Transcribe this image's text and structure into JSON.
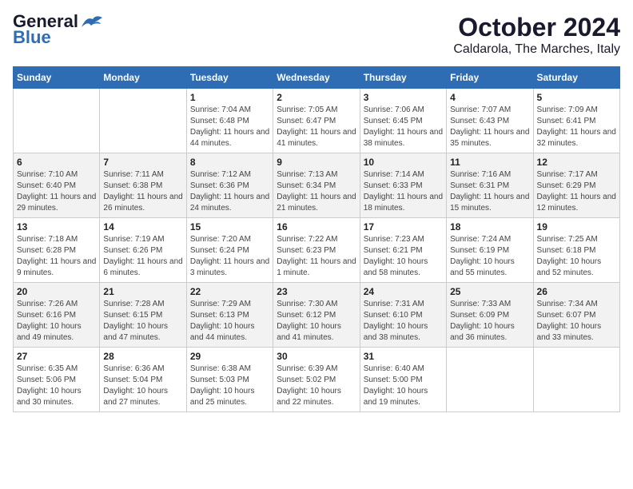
{
  "logo": {
    "line1": "General",
    "line2": "Blue"
  },
  "title": "October 2024",
  "subtitle": "Caldarola, The Marches, Italy",
  "days_header": [
    "Sunday",
    "Monday",
    "Tuesday",
    "Wednesday",
    "Thursday",
    "Friday",
    "Saturday"
  ],
  "weeks": [
    [
      {
        "day": "",
        "info": ""
      },
      {
        "day": "",
        "info": ""
      },
      {
        "day": "1",
        "info": "Sunrise: 7:04 AM\nSunset: 6:48 PM\nDaylight: 11 hours and 44 minutes."
      },
      {
        "day": "2",
        "info": "Sunrise: 7:05 AM\nSunset: 6:47 PM\nDaylight: 11 hours and 41 minutes."
      },
      {
        "day": "3",
        "info": "Sunrise: 7:06 AM\nSunset: 6:45 PM\nDaylight: 11 hours and 38 minutes."
      },
      {
        "day": "4",
        "info": "Sunrise: 7:07 AM\nSunset: 6:43 PM\nDaylight: 11 hours and 35 minutes."
      },
      {
        "day": "5",
        "info": "Sunrise: 7:09 AM\nSunset: 6:41 PM\nDaylight: 11 hours and 32 minutes."
      }
    ],
    [
      {
        "day": "6",
        "info": "Sunrise: 7:10 AM\nSunset: 6:40 PM\nDaylight: 11 hours and 29 minutes."
      },
      {
        "day": "7",
        "info": "Sunrise: 7:11 AM\nSunset: 6:38 PM\nDaylight: 11 hours and 26 minutes."
      },
      {
        "day": "8",
        "info": "Sunrise: 7:12 AM\nSunset: 6:36 PM\nDaylight: 11 hours and 24 minutes."
      },
      {
        "day": "9",
        "info": "Sunrise: 7:13 AM\nSunset: 6:34 PM\nDaylight: 11 hours and 21 minutes."
      },
      {
        "day": "10",
        "info": "Sunrise: 7:14 AM\nSunset: 6:33 PM\nDaylight: 11 hours and 18 minutes."
      },
      {
        "day": "11",
        "info": "Sunrise: 7:16 AM\nSunset: 6:31 PM\nDaylight: 11 hours and 15 minutes."
      },
      {
        "day": "12",
        "info": "Sunrise: 7:17 AM\nSunset: 6:29 PM\nDaylight: 11 hours and 12 minutes."
      }
    ],
    [
      {
        "day": "13",
        "info": "Sunrise: 7:18 AM\nSunset: 6:28 PM\nDaylight: 11 hours and 9 minutes."
      },
      {
        "day": "14",
        "info": "Sunrise: 7:19 AM\nSunset: 6:26 PM\nDaylight: 11 hours and 6 minutes."
      },
      {
        "day": "15",
        "info": "Sunrise: 7:20 AM\nSunset: 6:24 PM\nDaylight: 11 hours and 3 minutes."
      },
      {
        "day": "16",
        "info": "Sunrise: 7:22 AM\nSunset: 6:23 PM\nDaylight: 11 hours and 1 minute."
      },
      {
        "day": "17",
        "info": "Sunrise: 7:23 AM\nSunset: 6:21 PM\nDaylight: 10 hours and 58 minutes."
      },
      {
        "day": "18",
        "info": "Sunrise: 7:24 AM\nSunset: 6:19 PM\nDaylight: 10 hours and 55 minutes."
      },
      {
        "day": "19",
        "info": "Sunrise: 7:25 AM\nSunset: 6:18 PM\nDaylight: 10 hours and 52 minutes."
      }
    ],
    [
      {
        "day": "20",
        "info": "Sunrise: 7:26 AM\nSunset: 6:16 PM\nDaylight: 10 hours and 49 minutes."
      },
      {
        "day": "21",
        "info": "Sunrise: 7:28 AM\nSunset: 6:15 PM\nDaylight: 10 hours and 47 minutes."
      },
      {
        "day": "22",
        "info": "Sunrise: 7:29 AM\nSunset: 6:13 PM\nDaylight: 10 hours and 44 minutes."
      },
      {
        "day": "23",
        "info": "Sunrise: 7:30 AM\nSunset: 6:12 PM\nDaylight: 10 hours and 41 minutes."
      },
      {
        "day": "24",
        "info": "Sunrise: 7:31 AM\nSunset: 6:10 PM\nDaylight: 10 hours and 38 minutes."
      },
      {
        "day": "25",
        "info": "Sunrise: 7:33 AM\nSunset: 6:09 PM\nDaylight: 10 hours and 36 minutes."
      },
      {
        "day": "26",
        "info": "Sunrise: 7:34 AM\nSunset: 6:07 PM\nDaylight: 10 hours and 33 minutes."
      }
    ],
    [
      {
        "day": "27",
        "info": "Sunrise: 6:35 AM\nSunset: 5:06 PM\nDaylight: 10 hours and 30 minutes."
      },
      {
        "day": "28",
        "info": "Sunrise: 6:36 AM\nSunset: 5:04 PM\nDaylight: 10 hours and 27 minutes."
      },
      {
        "day": "29",
        "info": "Sunrise: 6:38 AM\nSunset: 5:03 PM\nDaylight: 10 hours and 25 minutes."
      },
      {
        "day": "30",
        "info": "Sunrise: 6:39 AM\nSunset: 5:02 PM\nDaylight: 10 hours and 22 minutes."
      },
      {
        "day": "31",
        "info": "Sunrise: 6:40 AM\nSunset: 5:00 PM\nDaylight: 10 hours and 19 minutes."
      },
      {
        "day": "",
        "info": ""
      },
      {
        "day": "",
        "info": ""
      }
    ]
  ]
}
